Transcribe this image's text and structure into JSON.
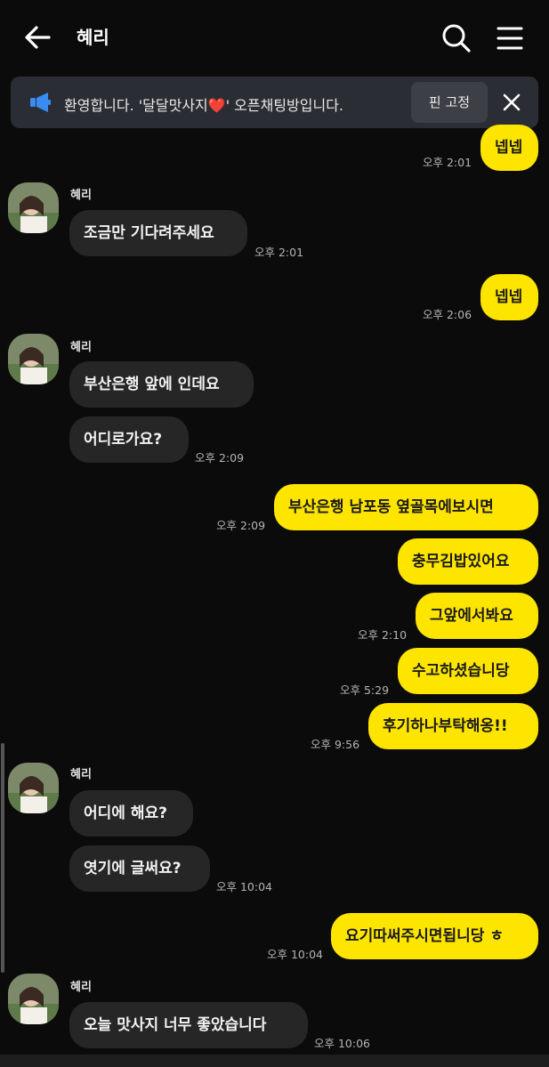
{
  "header": {
    "title": "혜리"
  },
  "notice": {
    "text": "환영합니다. '달달맛사지❤️' 오픈채팅방입니다.",
    "pin_label": "핀 고정"
  },
  "messages": [
    {
      "text": "넵넵",
      "time": "오후 2:01"
    },
    {
      "sender": "혜리",
      "text": "조금만 기다려주세요",
      "time": "오후 2:01"
    },
    {
      "text": "넵넵",
      "time": "오후 2:06"
    },
    {
      "sender": "혜리",
      "text": "부산은행 앞에 인데요"
    },
    {
      "text": "어디로가요?",
      "time": "오후 2:09"
    },
    {
      "text": "부산은행 남포동 옆골목에보시면",
      "time": "오후 2:09"
    },
    {
      "text": "충무김밥있어요"
    },
    {
      "text": "그앞에서봐요",
      "time": "오후 2:10"
    },
    {
      "text": "수고하셨습니당",
      "time": "오후 5:29"
    },
    {
      "text": "후기하나부탁해옹!!",
      "time": "오후 9:56"
    },
    {
      "sender": "혜리",
      "text": "어디에 해요?"
    },
    {
      "text": "엿기에 글써요?",
      "time": "오후 10:04"
    },
    {
      "text": "요기따써주시면됩니당 ㅎ",
      "time": "오후 10:04"
    },
    {
      "sender": "혜리",
      "text": "오늘 맛사지 너무 좋았습니다",
      "time": "오후 10:06"
    }
  ],
  "colors": {
    "sent_bubble": "#fee500",
    "received_bubble": "#262626",
    "background": "#0b0b0b"
  }
}
